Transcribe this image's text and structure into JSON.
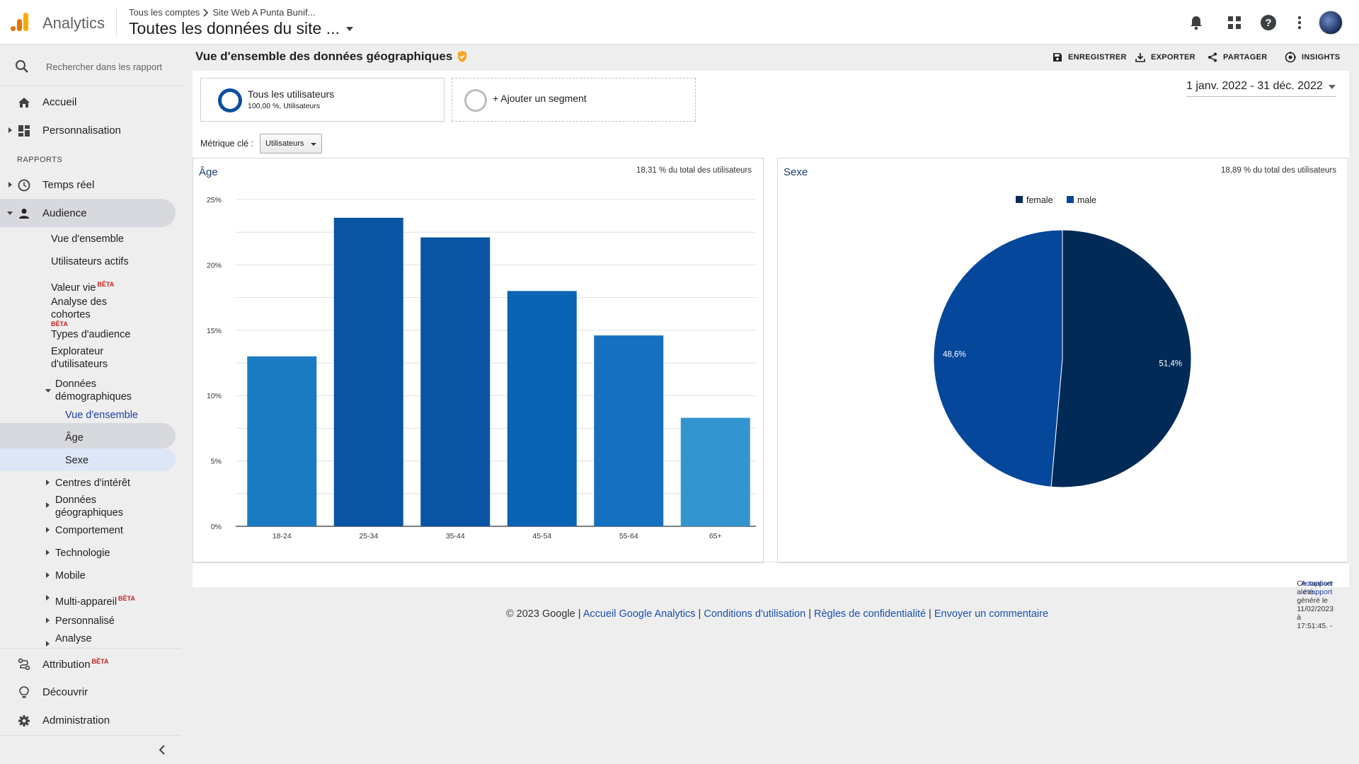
{
  "header": {
    "app_name": "Analytics",
    "breadcrumb_account": "Tous les comptes",
    "breadcrumb_property": "Site Web A Punta Bunif...",
    "view_title": "Toutes les données du site ..."
  },
  "sidebar": {
    "search_placeholder": "Rechercher dans les rapport",
    "home": "Accueil",
    "customization": "Personnalisation",
    "reports_label": "RAPPORTS",
    "realtime": "Temps réel",
    "audience": "Audience",
    "audience_items": {
      "overview": "Vue d'ensemble",
      "active_users": "Utilisateurs actifs",
      "lifetime_value": "Valeur vie",
      "cohort_line1": "Analyse des",
      "cohort_line2": "cohortes",
      "audience_types": "Types d'audience",
      "explorer_line1": "Explorateur",
      "explorer_line2": "d'utilisateurs",
      "demographics_line1": "Données",
      "demographics_line2": "démographiques",
      "demo_overview": "Vue d'ensemble",
      "demo_age": "Âge",
      "demo_gender": "Sexe",
      "interests": "Centres d'intérêt",
      "geo_line1": "Données",
      "geo_line2": "géographiques",
      "behavior": "Comportement",
      "technology": "Technologie",
      "mobile": "Mobile",
      "cross_device": "Multi-appareil",
      "custom": "Personnalisé",
      "analysis_cut": "Analyse"
    },
    "beta": "BÊTA",
    "attribution": "Attribution",
    "discover": "Découvrir",
    "admin": "Administration"
  },
  "main": {
    "page_title": "Vue d'ensemble des données géographiques",
    "toolbar": {
      "save": "ENREGISTRER",
      "export": "EXPORTER",
      "share": "PARTAGER",
      "insights": "INSIGHTS"
    },
    "segment": {
      "name": "Tous les utilisateurs",
      "detail": "100,00 %, Utilisateurs",
      "add": "+ Ajouter un segment"
    },
    "date_range": "1 janv. 2022 - 31 déc. 2022",
    "metric_label": "Métrique clé :",
    "metric_value": "Utilisateurs",
    "age_card": {
      "title": "Âge",
      "subtitle": "18,31 % du total des utilisateurs"
    },
    "gender_card": {
      "title": "Sexe",
      "subtitle": "18,89 % du total des utilisateurs"
    },
    "report_generated": "Ce rapport a été généré le 11/02/2023 à 17:51:45. - ",
    "refresh_link": "Actualiser le rapport"
  },
  "footer": {
    "copyright": "© 2023 Google | ",
    "link_home": "Accueil Google Analytics",
    "sep1": " | ",
    "link_terms": "Conditions d'utilisation",
    "sep2": " | ",
    "link_privacy": "Règles de confidentialité",
    "sep3": " | ",
    "link_feedback": "Envoyer un commentaire"
  },
  "colors": {
    "bar_light": "#1a7bc3",
    "bar_dark": "#0a55a3",
    "pie_female": "#012a57",
    "pie_male": "#05479a",
    "accent_orange": "#f5a623"
  },
  "chart_data": [
    {
      "type": "bar",
      "title": "Âge",
      "categories": [
        "18-24",
        "25-34",
        "35-44",
        "45-54",
        "55-64",
        "65+"
      ],
      "values": [
        13.0,
        23.6,
        22.1,
        18.0,
        14.6,
        8.3
      ],
      "ylim": [
        0,
        25
      ],
      "yticks": [
        "0%",
        "5%",
        "10%",
        "15%",
        "20%",
        "25%"
      ],
      "grid": true
    },
    {
      "type": "pie",
      "title": "Sexe",
      "categories": [
        "female",
        "male"
      ],
      "values": [
        51.4,
        48.6
      ],
      "labels": [
        "51,4%",
        "48,6%"
      ],
      "legend": "top"
    }
  ]
}
